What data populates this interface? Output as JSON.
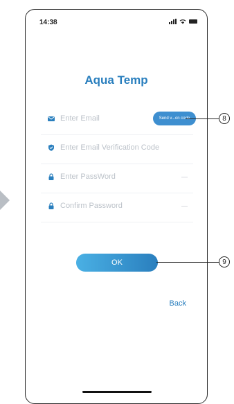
{
  "status_bar": {
    "time": "14:38"
  },
  "app": {
    "title": "Aqua Temp"
  },
  "form": {
    "email_placeholder": "Enter Email",
    "send_code_label": "Send v...on code",
    "verification_placeholder": "Enter Email Verification Code",
    "password_placeholder": "Enter PassWord",
    "confirm_placeholder": "Confirm Password",
    "eye_glyph": "—"
  },
  "ok_label": "OK",
  "back_label": "Back",
  "callouts": [
    "8",
    "9"
  ],
  "colors": {
    "accent": "#2a7fbe",
    "button": "#3e8fd0",
    "placeholder": "#bcc2c9"
  }
}
